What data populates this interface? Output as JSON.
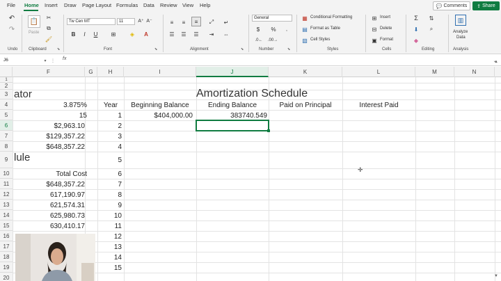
{
  "menu": {
    "tabs": [
      "File",
      "Home",
      "Insert",
      "Draw",
      "Page Layout",
      "Formulas",
      "Data",
      "Review",
      "View",
      "Help"
    ],
    "comments": "Comments",
    "share": "Share"
  },
  "ribbon": {
    "groups": [
      "Undo",
      "Clipboard",
      "Font",
      "Alignment",
      "Number",
      "Styles",
      "Cells",
      "Editing",
      "Analysis"
    ],
    "paste": "Paste",
    "font_name": "Tw Cen MT",
    "font_size": "11",
    "number_format": "General",
    "conditional_formatting": "Conditional Formatting",
    "format_as_table": "Format as Table",
    "cell_styles": "Cell Styles",
    "insert": "Insert",
    "delete": "Delete",
    "format": "Format",
    "analyze_data_line1": "Analyze",
    "analyze_data_line2": "Data"
  },
  "formula_bar": {
    "name_box": "J6",
    "fx": "fx"
  },
  "columns": [
    "F",
    "G",
    "H",
    "I",
    "J",
    "K",
    "L",
    "M",
    "N"
  ],
  "rows": [
    "1",
    "2",
    "3",
    "4",
    "5",
    "6",
    "7",
    "8",
    "9",
    "10",
    "11",
    "12",
    "13",
    "14",
    "15",
    "16",
    "17",
    "18",
    "19",
    "20"
  ],
  "sheet": {
    "title": "Amortization Schedule",
    "partial_e3": "ator",
    "partial_e9": "lule",
    "headers": {
      "year": "Year",
      "beginning_balance": "Beginning Balance",
      "ending_balance": "Ending Balance",
      "paid_on_principal": "Paid on Principal",
      "interest_paid": "Interest Paid"
    },
    "f_values": {
      "r4": "3.875%",
      "r5": "15",
      "r6": "$2,963.10",
      "r7": "$129,357.22",
      "r8": "$648,357.22",
      "r10": "Total Cost",
      "r11": "$648,357.22",
      "r12": "617,190.97",
      "r13": "621,574.31",
      "r14": "625,980.73",
      "r15": "630,410.17"
    },
    "years": [
      "1",
      "2",
      "3",
      "4",
      "5",
      "6",
      "7",
      "8",
      "9",
      "10",
      "11",
      "12",
      "13",
      "14",
      "15"
    ],
    "i5": "$404,000.00",
    "j5": "383740.549"
  }
}
